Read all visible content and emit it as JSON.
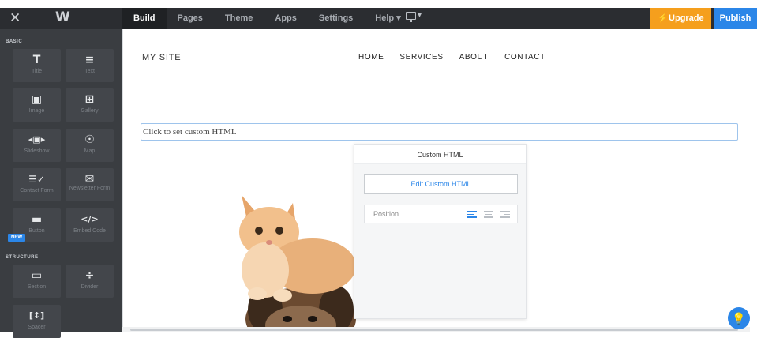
{
  "topbar": {
    "tabs": [
      "Build",
      "Pages",
      "Theme",
      "Apps",
      "Settings",
      "Help ▾"
    ],
    "active_tab": "Build",
    "device_dropdown": "▾",
    "upgrade_label": "⚡Upgrade",
    "publish_label": "Publish"
  },
  "sidebar": {
    "basic_label": "BASIC",
    "structure_label": "STRUCTURE",
    "new_badge": "NEW",
    "tiles": [
      {
        "label": "Title",
        "icon": "T"
      },
      {
        "label": "Text",
        "icon": "≡"
      },
      {
        "label": "Image",
        "icon": "▣"
      },
      {
        "label": "Gallery",
        "icon": "⊞"
      },
      {
        "label": "Slideshow",
        "icon": "◂▣▸"
      },
      {
        "label": "Map",
        "icon": "☉"
      },
      {
        "label": "Contact Form",
        "icon": "☰✓"
      },
      {
        "label": "Newsletter Form",
        "icon": "✉"
      },
      {
        "label": "Button",
        "icon": "▬"
      },
      {
        "label": "Embed Code",
        "icon": "</>"
      },
      {
        "label": "Section",
        "icon": "▭"
      },
      {
        "label": "Divider",
        "icon": "÷"
      },
      {
        "label": "Spacer",
        "icon": "[↕]"
      }
    ]
  },
  "site": {
    "title": "MY SITE",
    "nav": [
      "HOME",
      "SERVICES",
      "ABOUT",
      "CONTACT"
    ],
    "custom_html_placeholder": "Click to set custom HTML"
  },
  "panel": {
    "title": "Custom HTML",
    "edit_button": "Edit Custom HTML",
    "position_label": "Position",
    "alignment_selected": "left"
  },
  "colors": {
    "accent": "#2b86e8",
    "upgrade": "#f59f1d",
    "topbar": "#2b2d31",
    "sidebar": "#3a3d41"
  }
}
